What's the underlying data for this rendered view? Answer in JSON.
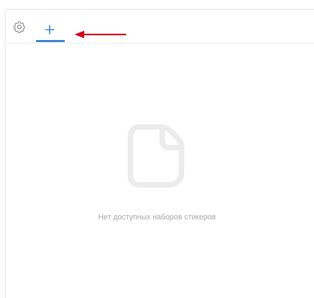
{
  "tabs": {
    "settings_icon": "gear-icon",
    "add_icon": "plus-icon",
    "active_tab_color": "#3b82d6"
  },
  "annotation": {
    "arrow_color": "#d0021b"
  },
  "empty_state": {
    "icon": "sticker-icon",
    "message": "Нет доступных наборов стикеров"
  }
}
